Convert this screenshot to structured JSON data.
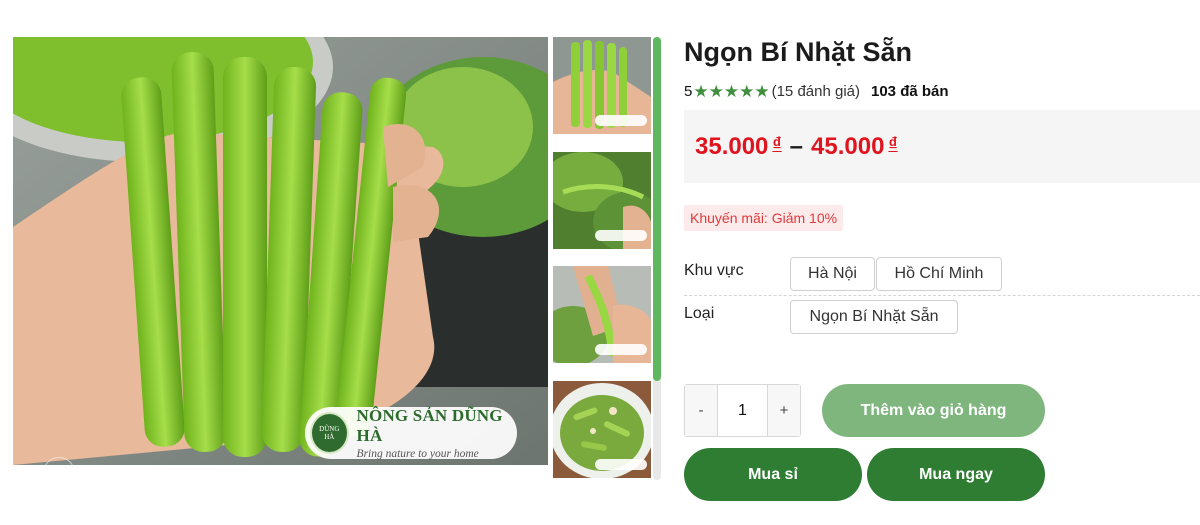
{
  "product": {
    "title": "Ngọn Bí Nhặt Sẵn",
    "rating_value": "5",
    "review_count": "(15 đánh giá)",
    "sold": "103 đã bán",
    "price_min": "35.000",
    "price_max": "45.000",
    "currency": "₫",
    "price_separator": "–",
    "promotion": "Khuyến mãi: Giảm 10%"
  },
  "image_logo": {
    "seal_line1": "DŨNG",
    "seal_line2": "HÀ",
    "brand": "NÔNG SẢN DŨNG HÀ",
    "slogan": "Bring nature to your home"
  },
  "options": {
    "region_label": "Khu vực",
    "region_values": [
      "Hà Nội",
      "Hồ Chí Minh"
    ],
    "type_label": "Loại",
    "type_values": [
      "Ngọn Bí Nhặt Sẵn"
    ]
  },
  "quantity": {
    "minus": "-",
    "value": "1",
    "plus": "+"
  },
  "actions": {
    "add_to_cart": "Thêm vào giỏ hàng",
    "wholesale": "Mua sỉ",
    "buy_now": "Mua ngay"
  },
  "icons": {
    "star": "star-icon",
    "zoom": "expand-icon"
  },
  "colors": {
    "brand_green": "#2e7d32",
    "cart_green": "#7eb67e",
    "price_red": "#e0141e",
    "star_green": "#3f8f3f",
    "promo_bg": "#fdeaea"
  }
}
